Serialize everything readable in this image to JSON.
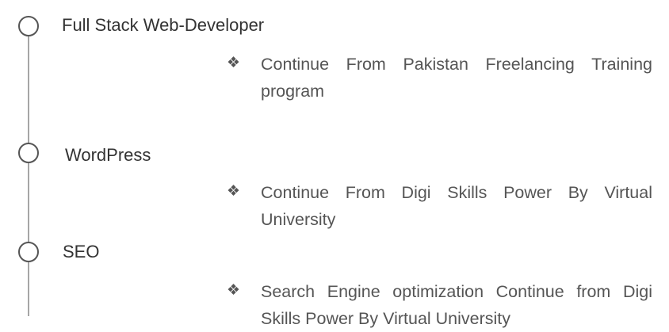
{
  "bullet_glyph": "❖",
  "entries": [
    {
      "title": "Full Stack Web-Developer",
      "description": "Continue From Pakistan Freelancing Training program"
    },
    {
      "title": "WordPress",
      "description": "Continue From Digi Skills Power By Virtual University"
    },
    {
      "title": "SEO",
      "description": "Search Engine optimization Continue from Digi Skills Power By Virtual University"
    }
  ]
}
